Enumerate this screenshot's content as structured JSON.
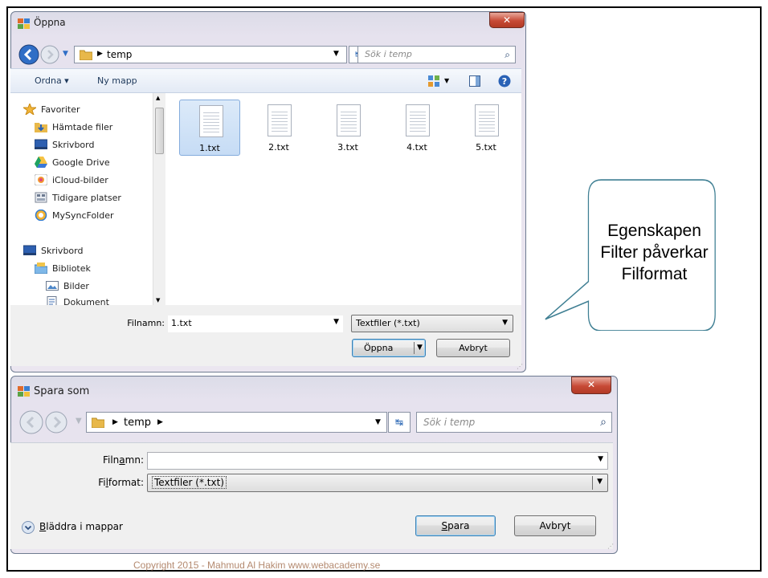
{
  "open_dialog": {
    "title": "Öppna",
    "address": {
      "crumb": "temp"
    },
    "search_placeholder": "Sök i temp",
    "toolbar": {
      "organize": "Ordna ▾",
      "new_folder": "Ny mapp"
    },
    "nav": [
      {
        "label": "Favoriter",
        "icon": "star-icon"
      },
      {
        "label": "Hämtade filer",
        "icon": "downloads-icon"
      },
      {
        "label": "Skrivbord",
        "icon": "desktop-icon"
      },
      {
        "label": "Google Drive",
        "icon": "google-drive-icon"
      },
      {
        "label": "iCloud-bilder",
        "icon": "icloud-photos-icon"
      },
      {
        "label": "Tidigare platser",
        "icon": "recent-places-icon"
      },
      {
        "label": "MySyncFolder",
        "icon": "sync-folder-icon"
      },
      {
        "label": "Skrivbord",
        "icon": "desktop-icon"
      },
      {
        "label": "Bibliotek",
        "icon": "library-icon"
      },
      {
        "label": "Bilder",
        "icon": "pictures-icon"
      },
      {
        "label": "Dokument",
        "icon": "documents-icon"
      }
    ],
    "files": [
      "1.txt",
      "2.txt",
      "3.txt",
      "4.txt",
      "5.txt"
    ],
    "filename_label": "Filnamn:",
    "filename_value": "1.txt",
    "filter_value": "Textfiler (*.txt)",
    "open_button": "Öppna",
    "cancel_button": "Avbryt"
  },
  "save_dialog": {
    "title": "Spara som",
    "address": {
      "crumb": "temp"
    },
    "search_placeholder": "Sök i temp",
    "filename_label": "Filnamn:",
    "filename_value": "",
    "format_label": "Filformat:",
    "format_value": "Textfiler (*.txt)",
    "browse_folders": "Bläddra i mappar",
    "save_button": "Spara",
    "cancel_button": "Avbryt"
  },
  "callout": {
    "line1": "Egenskapen",
    "line2": "Filter påverkar",
    "line3": "Filformat"
  },
  "copyright": "Copyright 2015 - Mahmud Al Hakim www.webacademy.se",
  "colors": {
    "close_button": "#c74a36",
    "selection": "#c6dcf5",
    "callout_border": "#3f7f93",
    "copyright": "#b48a70"
  }
}
